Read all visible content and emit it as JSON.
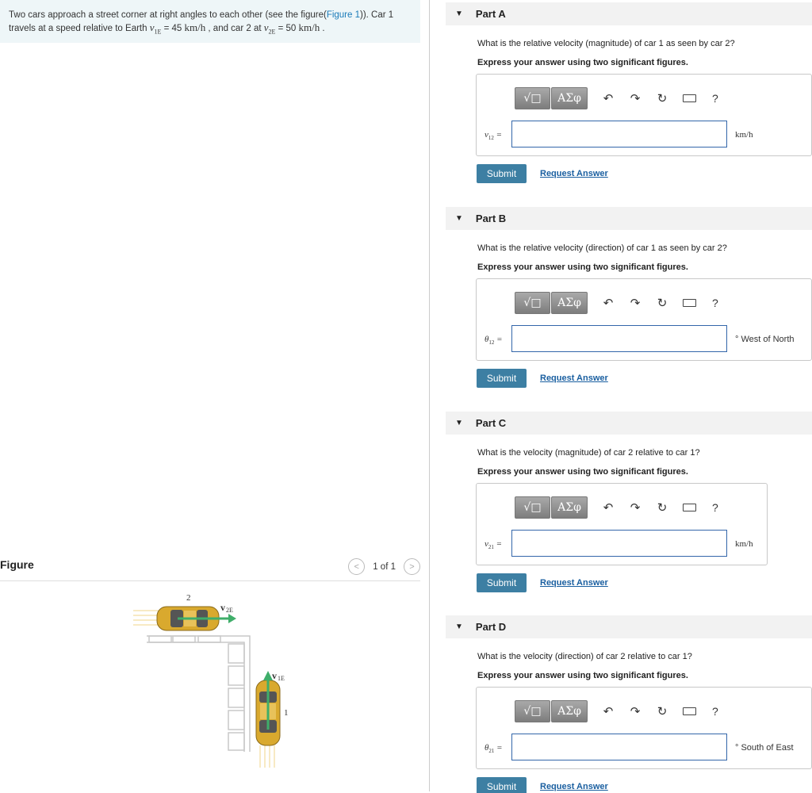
{
  "problem": {
    "text_1": "Two cars approach a street corner at right angles to each other (see the figure(",
    "figure_link": "Figure 1",
    "text_2": ")). Car 1",
    "text_3": "travels at a speed relative to Earth ",
    "v1_symbol": "v",
    "v1_sub": "1E",
    "v1_value": " = 45 ",
    "unit": "km/h",
    "text_4": " , and car 2 at ",
    "v2_symbol": "v",
    "v2_sub": "2E",
    "v2_value": " = 50 ",
    "text_5": " ."
  },
  "figure": {
    "title": "Figure",
    "pager_text": "1 of 1",
    "car2_number": "2",
    "car1_number": "1",
    "v2_label": "v",
    "v2_sub": "2E",
    "v1_label": "v",
    "v1_sub": "1E",
    "colors": {
      "car": "#d9a92e",
      "arrow": "#3fae6a",
      "road": "#c9c9c9"
    }
  },
  "toolbar": {
    "templates_label": "√□",
    "greek_label": "ΑΣφ",
    "undo_icon": "↶",
    "redo_icon": "↷",
    "reset_icon": "↻",
    "keyboard_icon": "keyboard-icon",
    "help_label": "?"
  },
  "parts": [
    {
      "title": "Part A",
      "question": "What is the relative velocity (magnitude) of car 1 as seen by car 2?",
      "instruction": "Express your answer using two significant figures.",
      "var_symbol": "v",
      "var_sub": "12",
      "equals": " =",
      "unit": "km/h",
      "submit": "Submit",
      "request": "Request Answer"
    },
    {
      "title": "Part B",
      "question": "What is the relative velocity (direction) of car 1 as seen by car 2?",
      "instruction": "Express your answer using two significant figures.",
      "var_symbol": "θ",
      "var_sub": "12",
      "equals": " =",
      "unit": "° West of North",
      "submit": "Submit",
      "request": "Request Answer"
    },
    {
      "title": "Part C",
      "question": "What is the velocity (magnitude) of car 2 relative to car 1?",
      "instruction": "Express your answer using two significant figures.",
      "var_symbol": "v",
      "var_sub": "21",
      "equals": " =",
      "unit": "km/h",
      "submit": "Submit",
      "request": "Request Answer"
    },
    {
      "title": "Part D",
      "question": "What is the velocity (direction) of car 2 relative to car 1?",
      "instruction": "Express your answer using two significant figures.",
      "var_symbol": "θ",
      "var_sub": "21",
      "equals": " =",
      "unit": "° South of East",
      "submit": "Submit",
      "request": "Request Answer"
    }
  ]
}
